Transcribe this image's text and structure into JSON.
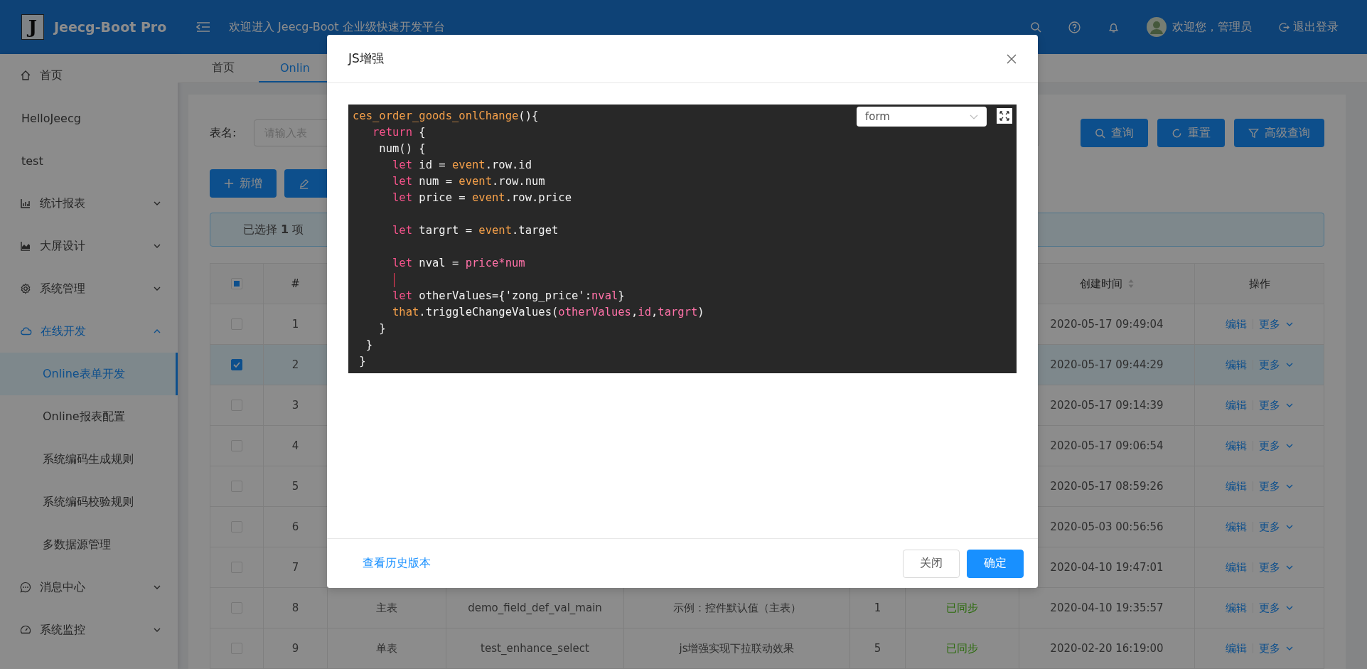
{
  "header": {
    "logo_letter": "J",
    "app_name": "Jeecg-Boot Pro",
    "welcome": "欢迎进入 Jeecg-Boot 企业级快速开发平台",
    "user_greeting": "欢迎您，管理员",
    "logout": "退出登录"
  },
  "sidebar": {
    "items": [
      {
        "label": "首页"
      },
      {
        "label": "HelloJeecg"
      },
      {
        "label": "test"
      },
      {
        "label": "统计报表",
        "expanded": false
      },
      {
        "label": "大屏设计",
        "expanded": false
      },
      {
        "label": "系统管理",
        "expanded": false
      },
      {
        "label": "在线开发",
        "expanded": true,
        "children": [
          {
            "label": "Online表单开发",
            "selected": true
          },
          {
            "label": "Online报表配置",
            "selected": false
          },
          {
            "label": "系统编码生成规则",
            "selected": false
          },
          {
            "label": "系统编码校验规则",
            "selected": false
          },
          {
            "label": "多数据源管理",
            "selected": false
          }
        ]
      },
      {
        "label": "消息中心",
        "expanded": false
      },
      {
        "label": "系统监控",
        "expanded": false
      }
    ]
  },
  "tabs": [
    {
      "label": "首页",
      "selected": false
    },
    {
      "label": "Onlin",
      "selected": true
    }
  ],
  "search": {
    "label": "表名:",
    "placeholder": "请输入表"
  },
  "query_buttons": [
    "查询",
    "重置",
    "高级查询"
  ],
  "toolbar_buttons": [
    "新增"
  ],
  "selection_alert": "已选择 **1** 项",
  "table": {
    "select_all": {
      "checked": false,
      "indeterminate": true
    },
    "columns": [
      "#",
      "创建时间",
      "操作"
    ],
    "rows": [
      {
        "selected": false,
        "number": "1",
        "created": "2020-05-17 09:49:04",
        "actions": [
          "编辑",
          "更多"
        ]
      },
      {
        "selected": true,
        "number": "2",
        "created": "2020-05-17 09:44:29",
        "actions": [
          "编辑",
          "更多"
        ]
      },
      {
        "selected": false,
        "number": "3",
        "created": "2020-05-17 09:14:39",
        "actions": [
          "编辑",
          "更多"
        ]
      },
      {
        "selected": false,
        "number": "4",
        "created": "2020-05-17 09:06:54",
        "actions": [
          "编辑",
          "更多"
        ]
      },
      {
        "selected": false,
        "number": "5",
        "created": "2020-05-17 08:59:26",
        "actions": [
          "编辑",
          "更多"
        ]
      },
      {
        "selected": false,
        "number": "6",
        "created": "2020-05-03 00:56:56",
        "actions": [
          "编辑",
          "更多"
        ]
      },
      {
        "selected": false,
        "number": "7",
        "created": "2020-04-10 19:47:01",
        "actions": [
          "编辑",
          "更多"
        ]
      },
      {
        "selected": false,
        "number": "8",
        "type": "主表",
        "table_name": "demo_field_def_val_main",
        "description": "示例：控件默认值（主表）",
        "version": "1",
        "sync_status": "已同步",
        "created": "2020-04-10 19:35:57",
        "actions": [
          "编辑",
          "更多"
        ]
      },
      {
        "selected": false,
        "number": "9",
        "type": "单表",
        "table_name": "test_enhance_select",
        "description": "js增强实现下拉联动效果",
        "version": "5",
        "sync_status": "已同步",
        "created": "2020-02-20 16:19:00",
        "actions": [
          "编辑",
          "更多"
        ]
      }
    ]
  },
  "modal": {
    "title": "JS增强",
    "mode_select": "form",
    "code_lines": [
      {
        "tokens": [
          {
            "text": "ces_order_goods_onlChange",
            "kind": "def"
          },
          {
            "text": "(){",
            "kind": "plain"
          }
        ]
      },
      {
        "tokens": [
          {
            "text": "   return",
            "kind": "keyword"
          },
          {
            "text": " {",
            "kind": "plain"
          }
        ]
      },
      {
        "tokens": [
          {
            "text": "    num() {",
            "kind": "plain"
          }
        ]
      },
      {
        "tokens": [
          {
            "text": "      let",
            "kind": "keyword"
          },
          {
            "text": " id = ",
            "kind": "plain"
          },
          {
            "text": "event",
            "kind": "def"
          },
          {
            "text": ".row.id",
            "kind": "plain"
          }
        ]
      },
      {
        "tokens": [
          {
            "text": "      let",
            "kind": "keyword"
          },
          {
            "text": " num = ",
            "kind": "plain"
          },
          {
            "text": "event",
            "kind": "def"
          },
          {
            "text": ".row.num",
            "kind": "plain"
          }
        ]
      },
      {
        "tokens": [
          {
            "text": "      let",
            "kind": "keyword"
          },
          {
            "text": " price = ",
            "kind": "plain"
          },
          {
            "text": "event",
            "kind": "def"
          },
          {
            "text": ".row.price",
            "kind": "plain"
          }
        ]
      },
      {
        "cursor": false
      },
      {
        "tokens": [
          {
            "text": "      let",
            "kind": "keyword"
          },
          {
            "text": " targrt = ",
            "kind": "plain"
          },
          {
            "text": "event",
            "kind": "def"
          },
          {
            "text": ".target",
            "kind": "plain"
          }
        ]
      },
      {
        "cursor": false
      },
      {
        "tokens": [
          {
            "text": "      let",
            "kind": "keyword"
          },
          {
            "text": " nval = ",
            "kind": "plain"
          },
          {
            "text": "price*num",
            "kind": "var"
          }
        ]
      },
      {
        "cursor": true
      },
      {
        "tokens": [
          {
            "text": "      let",
            "kind": "keyword"
          },
          {
            "text": " otherValues={'zong_price':",
            "kind": "plain"
          },
          {
            "text": "nval",
            "kind": "var"
          },
          {
            "text": "}",
            "kind": "plain"
          }
        ]
      },
      {
        "tokens": [
          {
            "text": "      that",
            "kind": "def"
          },
          {
            "text": ".triggleChangeValues(",
            "kind": "plain"
          },
          {
            "text": "otherValues",
            "kind": "var"
          },
          {
            "text": ",",
            "kind": "plain"
          },
          {
            "text": "id",
            "kind": "var"
          },
          {
            "text": ",",
            "kind": "plain"
          },
          {
            "text": "targrt",
            "kind": "var"
          },
          {
            "text": ")",
            "kind": "plain"
          }
        ]
      },
      {
        "tokens": [
          {
            "text": "    }",
            "kind": "plain"
          }
        ]
      },
      {
        "tokens": [
          {
            "text": "  }",
            "kind": "plain"
          }
        ]
      },
      {
        "tokens": [
          {
            "text": " }",
            "kind": "plain"
          }
        ]
      }
    ],
    "history_link": "查看历史版本",
    "buttons": [
      {
        "label": "关闭",
        "kind": "default"
      },
      {
        "label": "确定",
        "kind": "primary"
      }
    ]
  }
}
